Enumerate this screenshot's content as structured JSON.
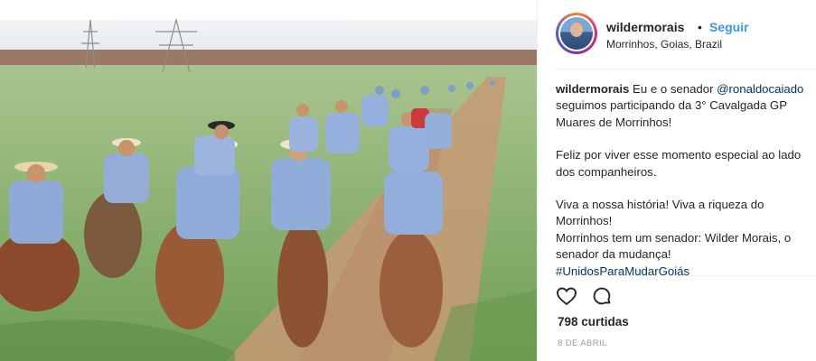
{
  "post": {
    "photo_alt": "Horse riders on a dirt road",
    "header": {
      "username": "wildermorais",
      "separator": "•",
      "follow_label": "Seguir",
      "location": "Morrinhos, Goias, Brazil"
    },
    "caption": {
      "username": "wildermorais",
      "line1_text": " Eu e o senador ",
      "mention": "@ronaldocaiado",
      "line1_rest": " seguimos participando da 3° Cavalgada GP Muares de Morrinhos!",
      "para2": "Feliz por viver esse momento especial ao lado dos companheiros.",
      "para3_a": "Viva a nossa história! Viva a riqueza do Morrinhos!",
      "para3_b": "Morrinhos tem um senador: Wilder Morais, o senador da mudança!",
      "hashtag": "#UnidosParaMudarGoiás"
    },
    "actions": {
      "like_icon": "heart-icon",
      "comment_icon": "comment-icon"
    },
    "likes_text": "798 curtidas",
    "date_text": "8 DE ABRIL"
  },
  "colors": {
    "link": "#003569",
    "follow": "#3897f0",
    "text": "#262626",
    "muted": "#999999"
  }
}
